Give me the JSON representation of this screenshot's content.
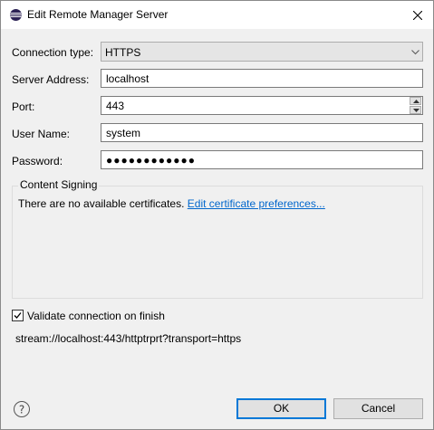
{
  "window": {
    "title": "Edit Remote Manager Server",
    "app_icon": "eclipse-icon",
    "close_icon": "close-icon"
  },
  "form": {
    "connection_type": {
      "label": "Connection type:",
      "value": "HTTPS"
    },
    "server_address": {
      "label": "Server Address:",
      "value": "localhost"
    },
    "port": {
      "label": "Port:",
      "value": "443"
    },
    "user_name": {
      "label": "User Name:",
      "value": "system"
    },
    "password": {
      "label": "Password:",
      "value": "●●●●●●●●●●●●"
    }
  },
  "content_signing": {
    "title": "Content Signing",
    "message": "There are no available certificates.",
    "link": "Edit certificate preferences..."
  },
  "validate": {
    "label": "Validate connection on finish",
    "checked": true
  },
  "url": "stream://localhost:443/httptrprt?transport=https",
  "buttons": {
    "ok": "OK",
    "cancel": "Cancel",
    "help_icon": "help-icon"
  }
}
